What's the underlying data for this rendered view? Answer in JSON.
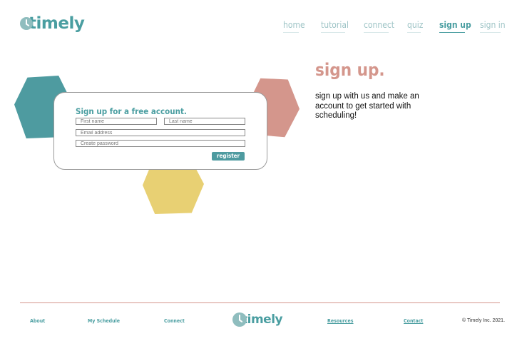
{
  "header": {
    "logo_text": "timely",
    "nav": [
      {
        "label": "home"
      },
      {
        "label": "tutorial"
      },
      {
        "label": "connect"
      },
      {
        "label": "quiz"
      },
      {
        "label": "sign up"
      },
      {
        "label": "sign in"
      }
    ]
  },
  "form": {
    "title": "Sign up for a free account.",
    "first_name_placeholder": "First name",
    "last_name_placeholder": "Last name",
    "email_placeholder": "Email address",
    "password_placeholder": "Create password",
    "register_label": "register"
  },
  "main": {
    "heading": "sign up.",
    "description": "sign up with us and make an account to get started with scheduling!"
  },
  "footer": {
    "links": [
      {
        "label": "About"
      },
      {
        "label": "My Schedule"
      },
      {
        "label": "Connect"
      },
      {
        "label": "Resources"
      },
      {
        "label": "Contact"
      }
    ],
    "logo_text": "timely",
    "copyright": "© Timely Inc. 2021."
  },
  "colors": {
    "teal": "#4e9ba0",
    "coral": "#d4968c",
    "yellow": "#e8d073",
    "nav_inactive": "#9ec4c6"
  }
}
